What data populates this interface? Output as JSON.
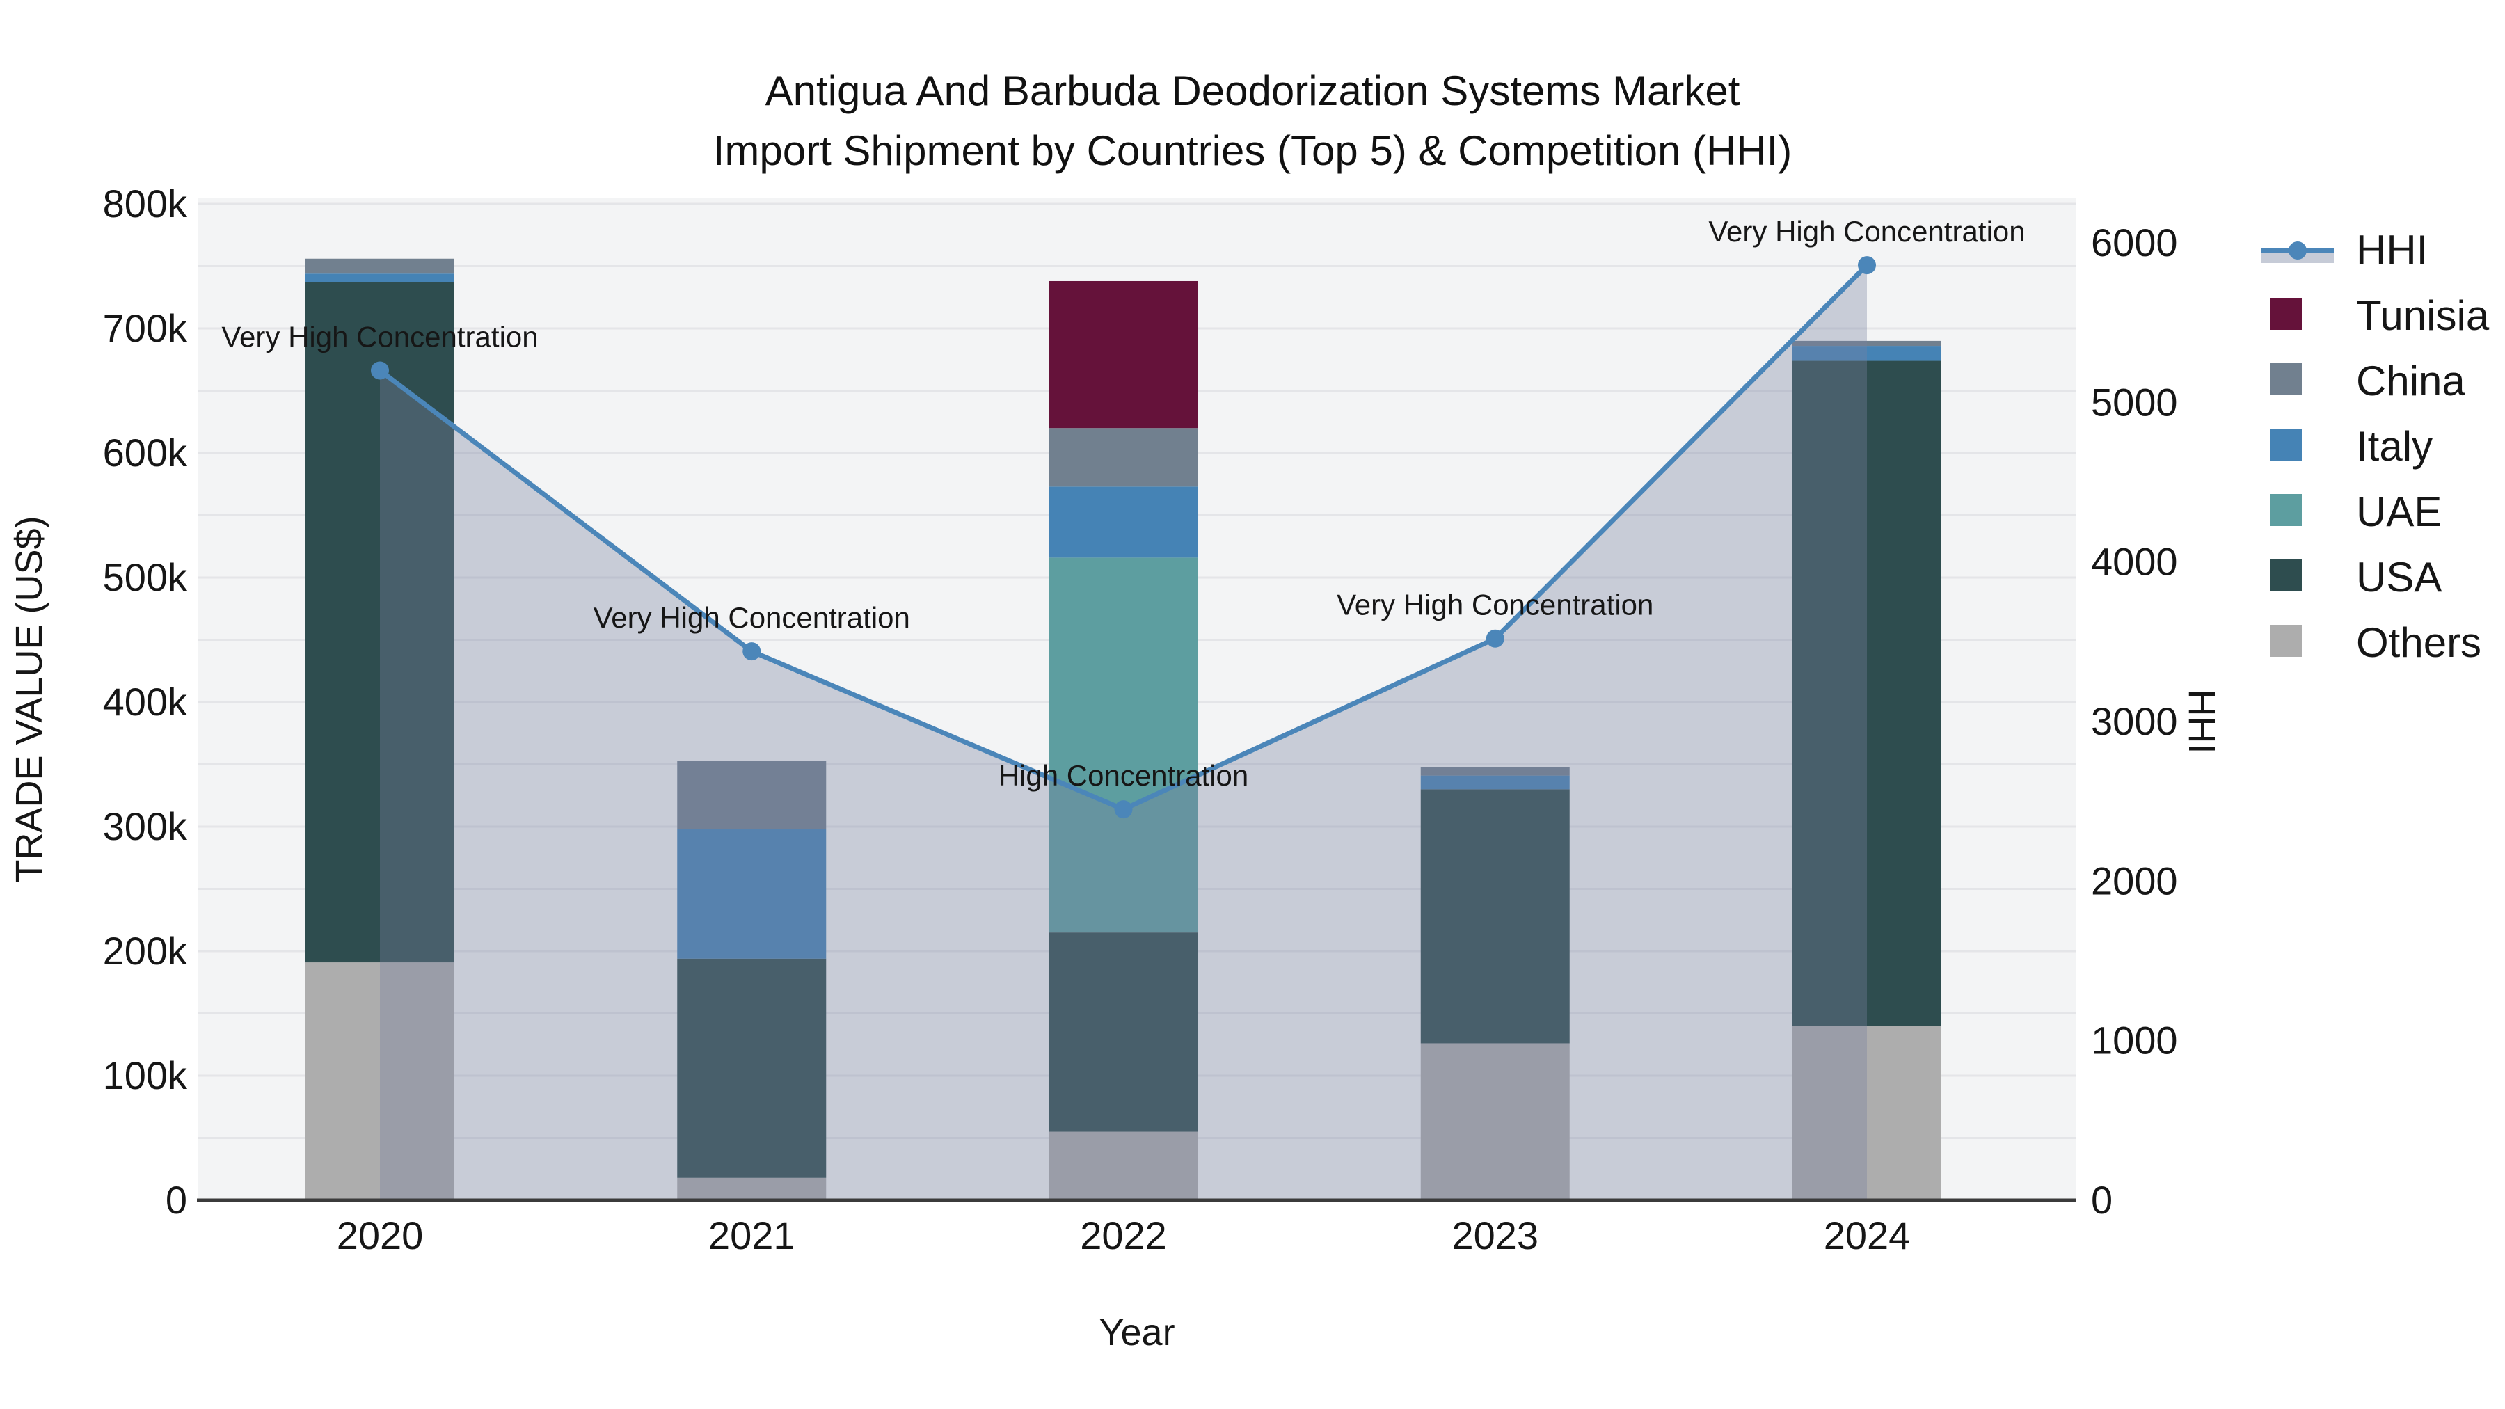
{
  "title": {
    "line1": "Antigua And Barbuda Deodorization Systems Market",
    "line2": "Import Shipment by Countries (Top 5) & Competition (HHI)"
  },
  "chart_data": {
    "type": "bar+line",
    "categories": [
      "2020",
      "2021",
      "2022",
      "2023",
      "2024"
    ],
    "bar_series": [
      {
        "name": "Others",
        "color": "#adadad",
        "values": [
          191000,
          18000,
          55000,
          126000,
          140000
        ]
      },
      {
        "name": "USA",
        "color": "#2e4d4f",
        "values": [
          546000,
          176000,
          160000,
          204000,
          534000
        ]
      },
      {
        "name": "UAE",
        "color": "#5d9ea0",
        "values": [
          0,
          0,
          301000,
          0,
          0
        ]
      },
      {
        "name": "Italy",
        "color": "#4583b5",
        "values": [
          7000,
          104000,
          57000,
          11000,
          12000
        ]
      },
      {
        "name": "China",
        "color": "#71808f",
        "values": [
          12000,
          55000,
          47000,
          7000,
          4000
        ]
      },
      {
        "name": "Tunisia",
        "color": "#65123a",
        "values": [
          0,
          0,
          118000,
          0,
          0
        ]
      }
    ],
    "line_series": {
      "name": "HHI",
      "color": "#4b86b9",
      "area_color": "#7882a0",
      "area_opacity": 0.35,
      "values": [
        5200,
        3440,
        2450,
        3520,
        5860
      ]
    },
    "annotations": [
      "Very High Concentration",
      "Very High Concentration",
      "High Concentration",
      "Very High Concentration",
      "Very High Concentration"
    ],
    "xlabel": "Year",
    "ylabel_left": "TRADE VALUE (US$)",
    "ylabel_right": "HHI",
    "y_left": {
      "min": 0,
      "max": 800000,
      "tick_step": 100000,
      "tick_labels": [
        "0",
        "100k",
        "200k",
        "300k",
        "400k",
        "500k",
        "600k",
        "700k",
        "800k"
      ]
    },
    "y_right": {
      "min": 0,
      "max": 6000,
      "tick_step": 1000,
      "tick_labels": [
        "0",
        "1000",
        "2000",
        "3000",
        "4000",
        "5000",
        "6000"
      ]
    },
    "legend_order": [
      "HHI",
      "Tunisia",
      "China",
      "Italy",
      "UAE",
      "USA",
      "Others"
    ],
    "legend_position": "right"
  },
  "style_colors": {
    "plot_background": "#f3f4f5",
    "gridline": "#e4e5e8",
    "axis_line": "#3b3b3b",
    "text": "#161616"
  }
}
